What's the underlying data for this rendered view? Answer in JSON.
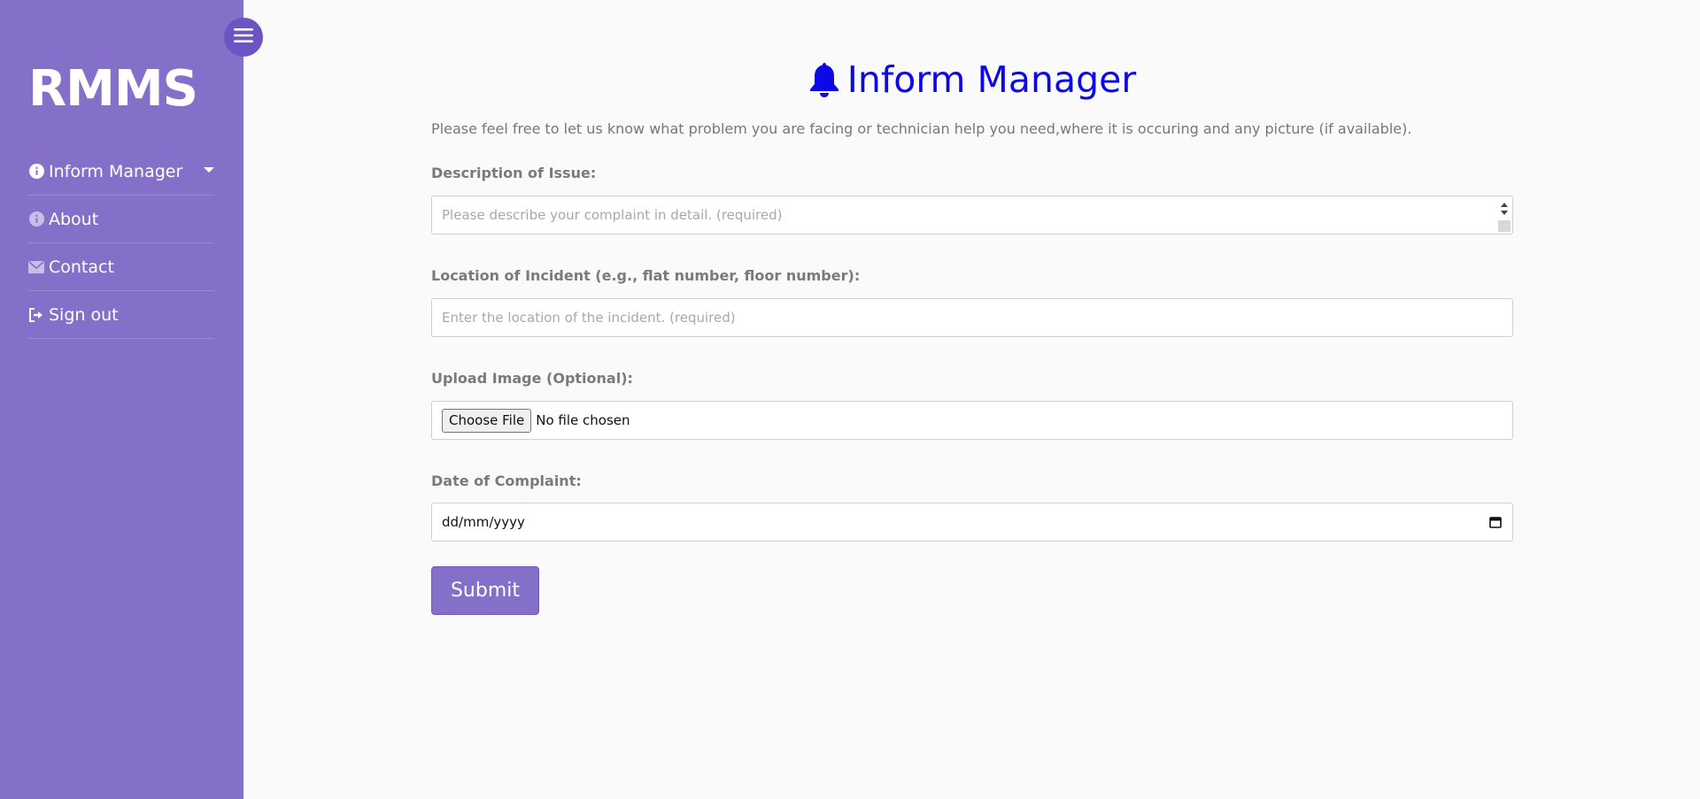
{
  "sidebar": {
    "brand": "RMMS",
    "items": [
      {
        "label": "Inform Manager",
        "icon": "info-icon",
        "has_dropdown": true
      },
      {
        "label": "About",
        "icon": "info-icon",
        "has_dropdown": false
      },
      {
        "label": "Contact",
        "icon": "envelope-icon",
        "has_dropdown": false
      },
      {
        "label": "Sign out",
        "icon": "sign-out-icon",
        "has_dropdown": false
      }
    ]
  },
  "main": {
    "title": "Inform Manager",
    "title_icon": "bell-icon",
    "intro": "Please feel free to let us know what problem you are facing or technician help you need,where it is occuring and any picture (if available).",
    "form": {
      "description": {
        "label": "Description of Issue:",
        "placeholder": "Please describe your complaint in detail. (required)"
      },
      "location": {
        "label": "Location of Incident (e.g., flat number, floor number):",
        "placeholder": "Enter the location of the incident. (required)"
      },
      "upload": {
        "label": "Upload Image (Optional):",
        "button_label": "Choose File",
        "status": "No file chosen"
      },
      "date": {
        "label": "Date of Complaint:",
        "value": "dd/mm/yyyy"
      },
      "submit_label": "Submit"
    }
  },
  "colors": {
    "sidebar_bg": "#8570c9",
    "toggle_bg": "#6c55c2",
    "title": "#0c09e6",
    "page_bg": "#fafafa"
  }
}
